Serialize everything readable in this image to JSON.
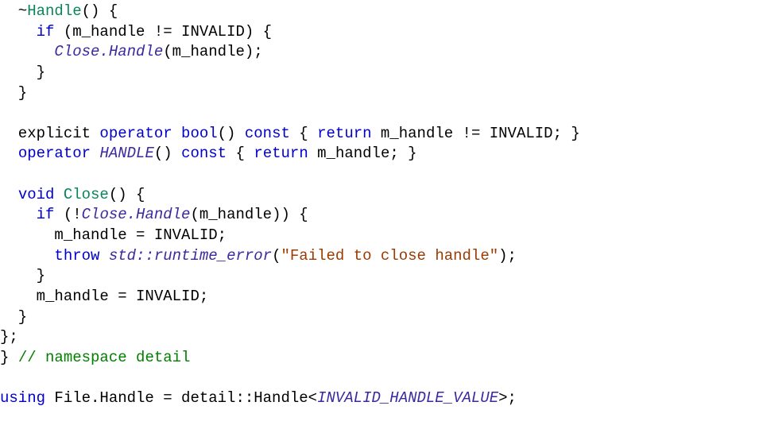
{
  "code": {
    "l1a": "  ~",
    "l1b": "Handle",
    "l1c": "() {",
    "l2a": "    ",
    "l2b": "if",
    "l2c": " (m_handle != INVALID) {",
    "l3a": "      ",
    "l3b": "Close.Handle",
    "l3c": "(m_handle);",
    "l4": "    }",
    "l5": "  }",
    "l6": "",
    "l7a": "  explicit ",
    "l7b": "operator",
    "l7c": " ",
    "l7d": "bool",
    "l7e": "() ",
    "l7f": "const",
    "l7g": " { ",
    "l7h": "return",
    "l7i": " m_handle != INVALID; }",
    "l8a": "  ",
    "l8b": "operator",
    "l8c": " ",
    "l8d": "HANDLE",
    "l8e": "() ",
    "l8f": "const",
    "l8g": " { ",
    "l8h": "return",
    "l8i": " m_handle; }",
    "l9": "",
    "l10a": "  ",
    "l10b": "void",
    "l10c": " ",
    "l10d": "Close",
    "l10e": "() {",
    "l11a": "    ",
    "l11b": "if",
    "l11c": " (!",
    "l11d": "Close.Handle",
    "l11e": "(m_handle)) {",
    "l12": "      m_handle = INVALID;",
    "l13a": "      ",
    "l13b": "throw",
    "l13c": " ",
    "l13d": "std::runtime_error",
    "l13e": "(",
    "l13f": "\"Failed to close handle\"",
    "l13g": ");",
    "l14": "    }",
    "l15": "    m_handle = INVALID;",
    "l16": "  }",
    "l17": "};",
    "l18a": "} ",
    "l18b": "// namespace detail",
    "l19": "",
    "l20a": "using",
    "l20b": " File.Handle = detail::Handle<",
    "l20c": "INVALID_HANDLE_VALUE",
    "l20d": ">;"
  }
}
